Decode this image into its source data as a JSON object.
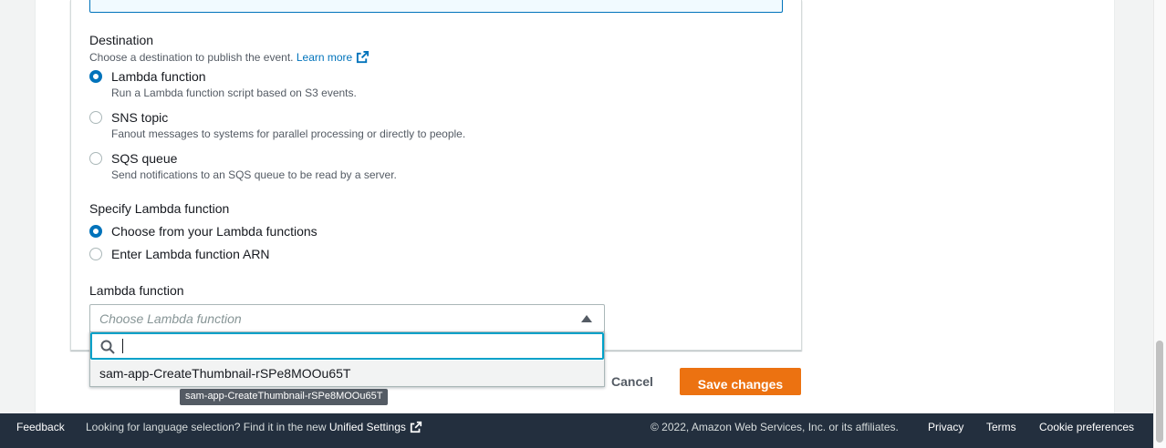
{
  "destination": {
    "title": "Destination",
    "description": "Choose a destination to publish the event.",
    "learn_more": "Learn more",
    "options": [
      {
        "label": "Lambda function",
        "desc": "Run a Lambda function script based on S3 events.",
        "checked": true
      },
      {
        "label": "SNS topic",
        "desc": "Fanout messages to systems for parallel processing or directly to people.",
        "checked": false
      },
      {
        "label": "SQS queue",
        "desc": "Send notifications to an SQS queue to be read by a server.",
        "checked": false
      }
    ]
  },
  "specify_lambda": {
    "title": "Specify Lambda function",
    "options": [
      {
        "label": "Choose from your Lambda functions",
        "checked": true
      },
      {
        "label": "Enter Lambda function ARN",
        "checked": false
      }
    ]
  },
  "lambda_select": {
    "label": "Lambda function",
    "placeholder": "Choose Lambda function",
    "search_value": "",
    "options": [
      "sam-app-CreateThumbnail-rSPe8MOOu65T"
    ],
    "tooltip": "sam-app-CreateThumbnail-rSPe8MOOu65T"
  },
  "actions": {
    "cancel": "Cancel",
    "save": "Save changes"
  },
  "footer": {
    "feedback": "Feedback",
    "language_prompt": "Looking for language selection? Find it in the new",
    "unified_settings": "Unified Settings",
    "copyright": "© 2022, Amazon Web Services, Inc. or its affiliates.",
    "privacy": "Privacy",
    "terms": "Terms",
    "cookie": "Cookie preferences"
  },
  "colors": {
    "accent": "#0073bb",
    "primary_button": "#ec7211",
    "footer_bg": "#232f3e",
    "focus": "#00a1c9"
  }
}
